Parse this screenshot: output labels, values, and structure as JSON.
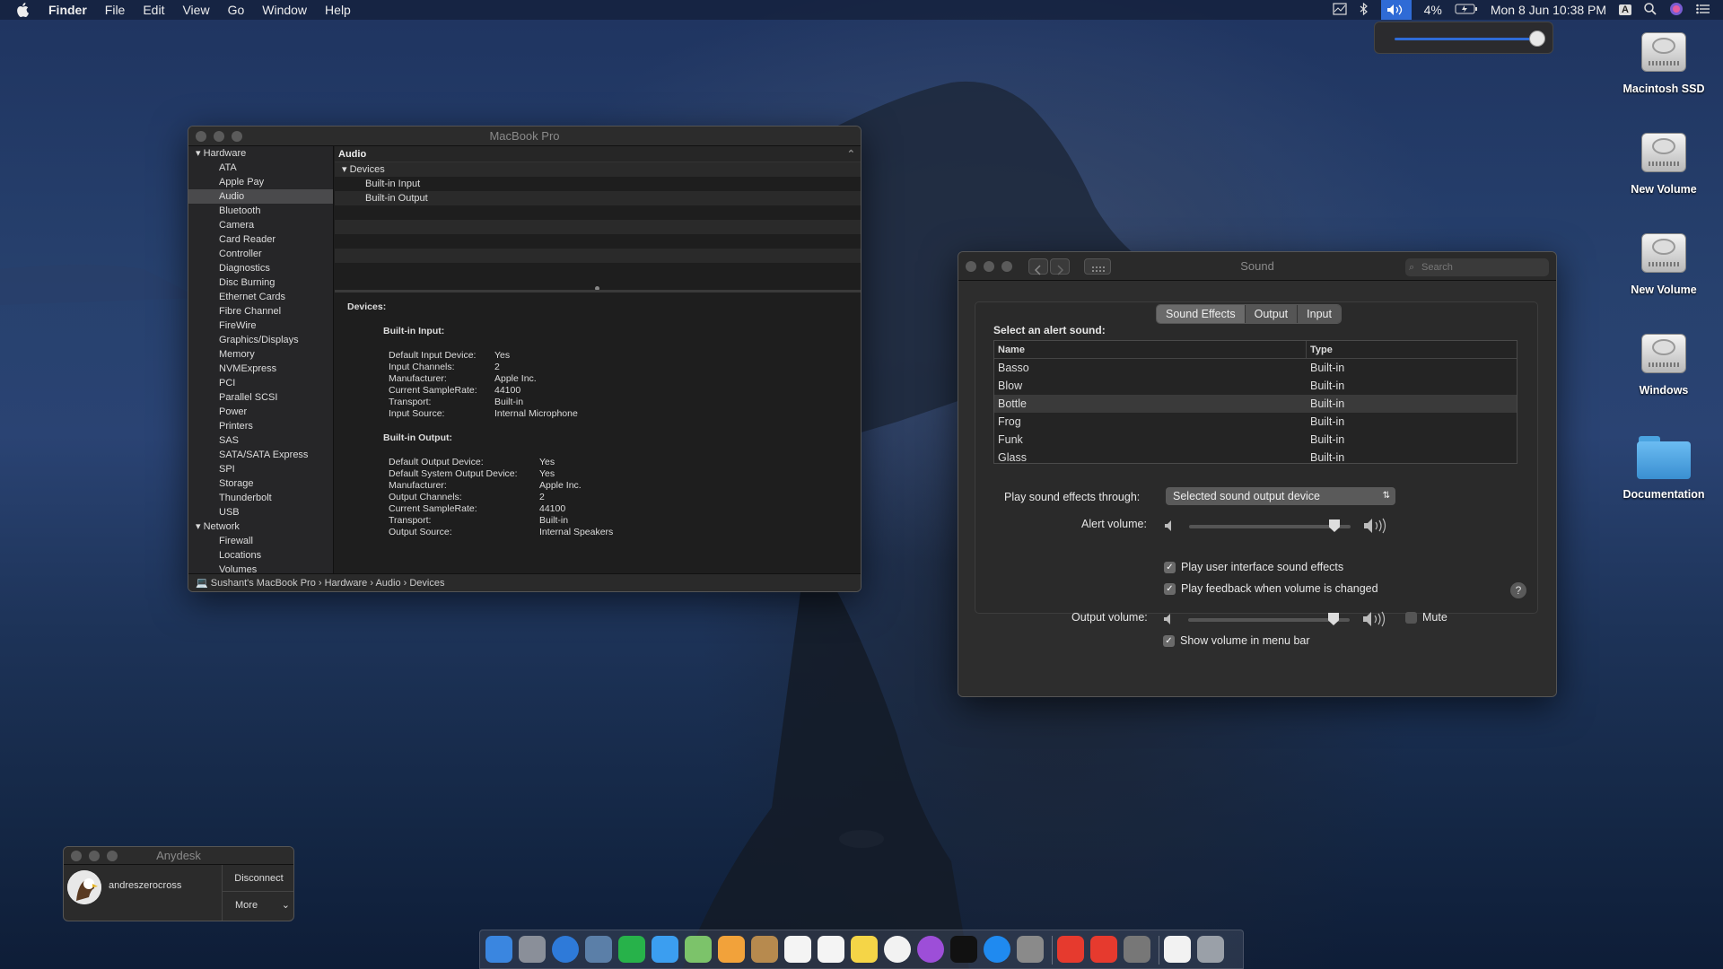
{
  "menubar": {
    "app": "Finder",
    "items": [
      "File",
      "Edit",
      "View",
      "Go",
      "Window",
      "Help"
    ],
    "battery": "4%",
    "clock": "Mon 8 Jun  10:38 PM",
    "input_source": "A"
  },
  "desktop": {
    "icons": [
      "Macintosh SSD",
      "New Volume",
      "New Volume",
      "Windows",
      "Documentation"
    ]
  },
  "sysinfo": {
    "title": "MacBook Pro",
    "sidebar": [
      {
        "label": "Hardware",
        "group": true
      },
      {
        "label": "ATA"
      },
      {
        "label": "Apple Pay"
      },
      {
        "label": "Audio",
        "selected": true
      },
      {
        "label": "Bluetooth"
      },
      {
        "label": "Camera"
      },
      {
        "label": "Card Reader"
      },
      {
        "label": "Controller"
      },
      {
        "label": "Diagnostics"
      },
      {
        "label": "Disc Burning"
      },
      {
        "label": "Ethernet Cards"
      },
      {
        "label": "Fibre Channel"
      },
      {
        "label": "FireWire"
      },
      {
        "label": "Graphics/Displays"
      },
      {
        "label": "Memory"
      },
      {
        "label": "NVMExpress"
      },
      {
        "label": "PCI"
      },
      {
        "label": "Parallel SCSI"
      },
      {
        "label": "Power"
      },
      {
        "label": "Printers"
      },
      {
        "label": "SAS"
      },
      {
        "label": "SATA/SATA Express"
      },
      {
        "label": "SPI"
      },
      {
        "label": "Storage"
      },
      {
        "label": "Thunderbolt"
      },
      {
        "label": "USB"
      },
      {
        "label": "Network",
        "group": true
      },
      {
        "label": "Firewall"
      },
      {
        "label": "Locations"
      },
      {
        "label": "Volumes"
      }
    ],
    "list_header": "Audio",
    "list_group": "Devices",
    "list_items": [
      "Built-in Input",
      "Built-in Output"
    ],
    "detail_heading": "Devices:",
    "input_heading": "Built-in Input:",
    "input_rows": [
      [
        "Default Input Device:",
        "Yes"
      ],
      [
        "Input Channels:",
        "2"
      ],
      [
        "Manufacturer:",
        "Apple Inc."
      ],
      [
        "Current SampleRate:",
        "44100"
      ],
      [
        "Transport:",
        "Built-in"
      ],
      [
        "Input Source:",
        "Internal Microphone"
      ]
    ],
    "output_heading": "Built-in Output:",
    "output_rows": [
      [
        "Default Output Device:",
        "Yes"
      ],
      [
        "Default System Output Device:",
        "Yes"
      ],
      [
        "Manufacturer:",
        "Apple Inc."
      ],
      [
        "Output Channels:",
        "2"
      ],
      [
        "Current SampleRate:",
        "44100"
      ],
      [
        "Transport:",
        "Built-in"
      ],
      [
        "Output Source:",
        "Internal Speakers"
      ]
    ],
    "path": "Sushant's MacBook Pro  ›  Hardware  ›  Audio  ›  Devices"
  },
  "sound": {
    "title": "Sound",
    "search_placeholder": "Search",
    "tabs": [
      "Sound Effects",
      "Output",
      "Input"
    ],
    "select_label": "Select an alert sound:",
    "col_name": "Name",
    "col_type": "Type",
    "sounds": [
      [
        "Basso",
        "Built-in"
      ],
      [
        "Blow",
        "Built-in"
      ],
      [
        "Bottle",
        "Built-in"
      ],
      [
        "Frog",
        "Built-in"
      ],
      [
        "Funk",
        "Built-in"
      ],
      [
        "Glass",
        "Built-in"
      ]
    ],
    "selected_sound": "Bottle",
    "play_through_label": "Play sound effects through:",
    "play_through_value": "Selected sound output device",
    "alert_volume_label": "Alert volume:",
    "alert_volume": 0.9,
    "ui_sounds_label": "Play user interface sound effects",
    "ui_sounds_checked": true,
    "feedback_label": "Play feedback when volume is changed",
    "feedback_checked": true,
    "output_volume_label": "Output volume:",
    "output_volume": 0.9,
    "mute_label": "Mute",
    "mute_checked": false,
    "show_volume_label": "Show volume in menu bar",
    "show_volume_checked": true,
    "help": "?"
  },
  "anydesk": {
    "title": "Anydesk",
    "user": "andreszerocross",
    "disconnect": "Disconnect",
    "more": "More"
  },
  "menubar_volume": 0.95
}
